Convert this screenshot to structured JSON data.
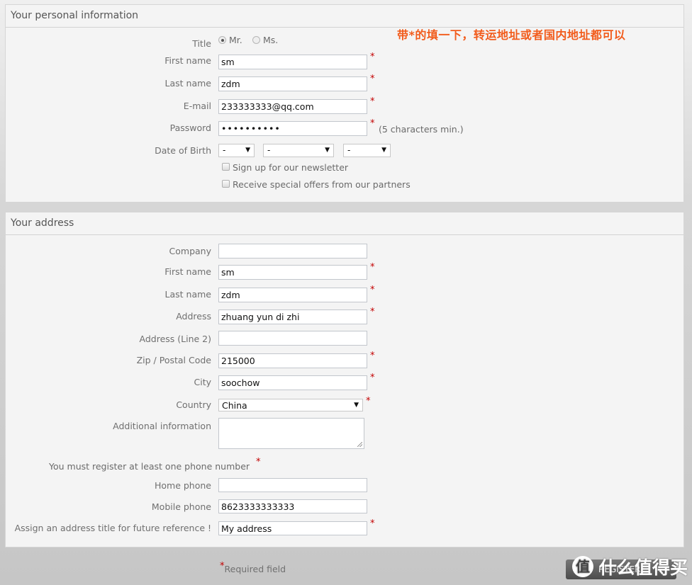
{
  "annotation": "带*的填一下，转运地址或者国内地址都可以",
  "personal": {
    "heading": "Your personal information",
    "title_label": "Title",
    "title_options": [
      {
        "label": "Mr.",
        "selected": true
      },
      {
        "label": "Ms.",
        "selected": false
      }
    ],
    "first_name_label": "First name",
    "first_name": "sm",
    "last_name_label": "Last name",
    "last_name": "zdm",
    "email_label": "E-mail",
    "email": "233333333@qq.com",
    "password_label": "Password",
    "password_mask": "••••••••••",
    "password_hint": "(5 characters min.)",
    "dob_label": "Date of Birth",
    "dob_day": "-",
    "dob_month": "-",
    "dob_year": "-",
    "newsletter_label": "Sign up for our newsletter",
    "offers_label": "Receive special offers from our partners"
  },
  "address": {
    "heading": "Your address",
    "company_label": "Company",
    "company": "",
    "first_name_label": "First name",
    "first_name": "sm",
    "last_name_label": "Last name",
    "last_name": "zdm",
    "address_label": "Address",
    "address": "zhuang yun di zhi",
    "address2_label": "Address (Line 2)",
    "address2": "",
    "zip_label": "Zip / Postal Code",
    "zip": "215000",
    "city_label": "City",
    "city": "soochow",
    "country_label": "Country",
    "country": "China",
    "additional_label": "Additional information",
    "additional": "",
    "phone_note": "You must register at least one phone number",
    "home_phone_label": "Home phone",
    "home_phone": "",
    "mobile_phone_label": "Mobile phone",
    "mobile_phone": "8623333333333",
    "alias_label": "Assign an address title for future reference !",
    "alias": "My address"
  },
  "required_marker": "*",
  "required_note": "Required field",
  "register_label": "REGISTER",
  "watermark": {
    "icon": "值",
    "text": "什么值得买"
  }
}
